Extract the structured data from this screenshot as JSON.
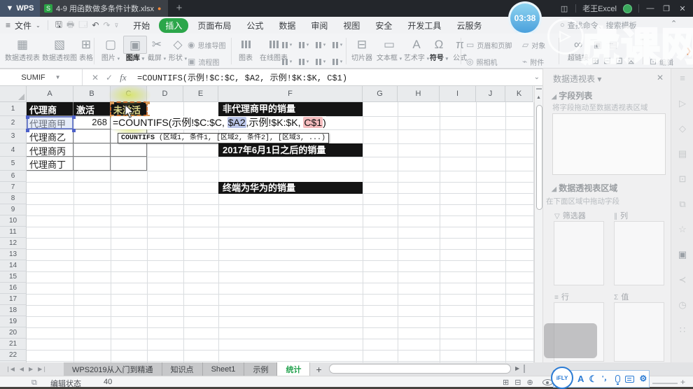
{
  "titlebar": {
    "app_name": "WPS",
    "doc_tab": "4-9 用函数做多条件计数.xlsx",
    "modified_dot": "●",
    "new_tab": "+",
    "timer": "03:38",
    "dock_glyph": "◫",
    "account_name": "老王Excel",
    "minimize": "—",
    "restore": "❐",
    "close": "✕"
  },
  "menubar": {
    "menu_toggle": "≡",
    "file": "文件",
    "file_caret": "⌄",
    "tabs": [
      "开始",
      "插入",
      "页面布局",
      "公式",
      "数据",
      "审阅",
      "视图",
      "安全",
      "开发工具",
      "云服务"
    ],
    "active_tab_index": 1,
    "search_icon": "🔍",
    "search_placeholder": "查找命令、搜索模板",
    "collapse_caret": "⌃"
  },
  "ribbon": {
    "items": [
      "数据透视表",
      "数据透视图",
      "表格",
      "图片",
      "图库",
      "截屏",
      "形状",
      "思维导图",
      "流程图",
      "图表",
      "在线图表",
      "切片器",
      "文本框",
      "艺术字",
      "符号",
      "公式",
      "页眉和页脚",
      "对象",
      "照相机",
      "附件",
      "超链接",
      "编辑"
    ],
    "expand_arrow": "❯"
  },
  "formula_bar": {
    "name_box": "SUMIF",
    "cancel": "✕",
    "accept": "✓",
    "fx": "fx",
    "formula": "=COUNTIFS(示例!$C:$C, $A2, 示例!$K:$K, C$1)",
    "collapse": "⌄"
  },
  "grid": {
    "columns": [
      "A",
      "B",
      "C",
      "D",
      "E",
      "F",
      "G",
      "H",
      "I",
      "J",
      "K"
    ],
    "row_count": 23,
    "table": [
      [
        "代理商",
        "激活",
        "未激活"
      ],
      [
        "代理商甲",
        "268",
        ""
      ],
      [
        "代理商乙",
        "",
        ""
      ],
      [
        "代理商丙",
        "",
        ""
      ],
      [
        "代理商丁",
        "",
        ""
      ]
    ],
    "banners": [
      "非代理商甲的销量",
      "2017年6月1日之后的销量",
      "终端为华为的销量"
    ],
    "cell_formula_parts": [
      {
        "t": "=COUNTIFS(示例!$C:$C, "
      },
      {
        "t": "$A2",
        "h": "blue"
      },
      {
        "t": ",示例!$K:$K, "
      },
      {
        "t": "C$1",
        "h": "red"
      },
      {
        "t": ")"
      }
    ],
    "tooltip_fn": "COUNTIFS",
    "tooltip_args": " (区域1, 条件1, [区域2, 条件2], [区域3, ...)"
  },
  "sheet_bar": {
    "tabs": [
      "WPS2019从入门到精通",
      "知识点",
      "Sheet1",
      "示例",
      "统计"
    ],
    "active_index": 4,
    "add_tab": "+"
  },
  "status_bar": {
    "mode_label": "编辑状态",
    "value": "40",
    "zoom_plus": "+"
  },
  "panel": {
    "title": "数据透视表",
    "title_caret": "▾",
    "close": "✕",
    "field_list_title": "字段列表",
    "field_list_hint": "将字段拖动至数据透视表区域",
    "areas_title": "数据透视表区域",
    "areas_hint": "在下面区域中拖动字段",
    "quadrants": [
      {
        "icon": "▽",
        "label": "筛选器"
      },
      {
        "icon": "∥",
        "label": "列"
      },
      {
        "icon": "≡",
        "label": "行"
      },
      {
        "icon": "Σ",
        "label": "值"
      }
    ]
  },
  "ime_toolbar": {
    "logo": "iFLY",
    "letter": "A",
    "moon": "☾",
    "punct": "'，",
    "gear": "⚙"
  },
  "watermark": {
    "text": "虎课网"
  },
  "colors": {
    "accent_green": "#2ca64a",
    "active_sheet_green": "#21a14d",
    "banner_bg": "#141414",
    "ref_blue_bg": "#bcc7ea",
    "ref_red_bg": "#f5bdbf",
    "timer_blue": "#4aa0dc"
  }
}
